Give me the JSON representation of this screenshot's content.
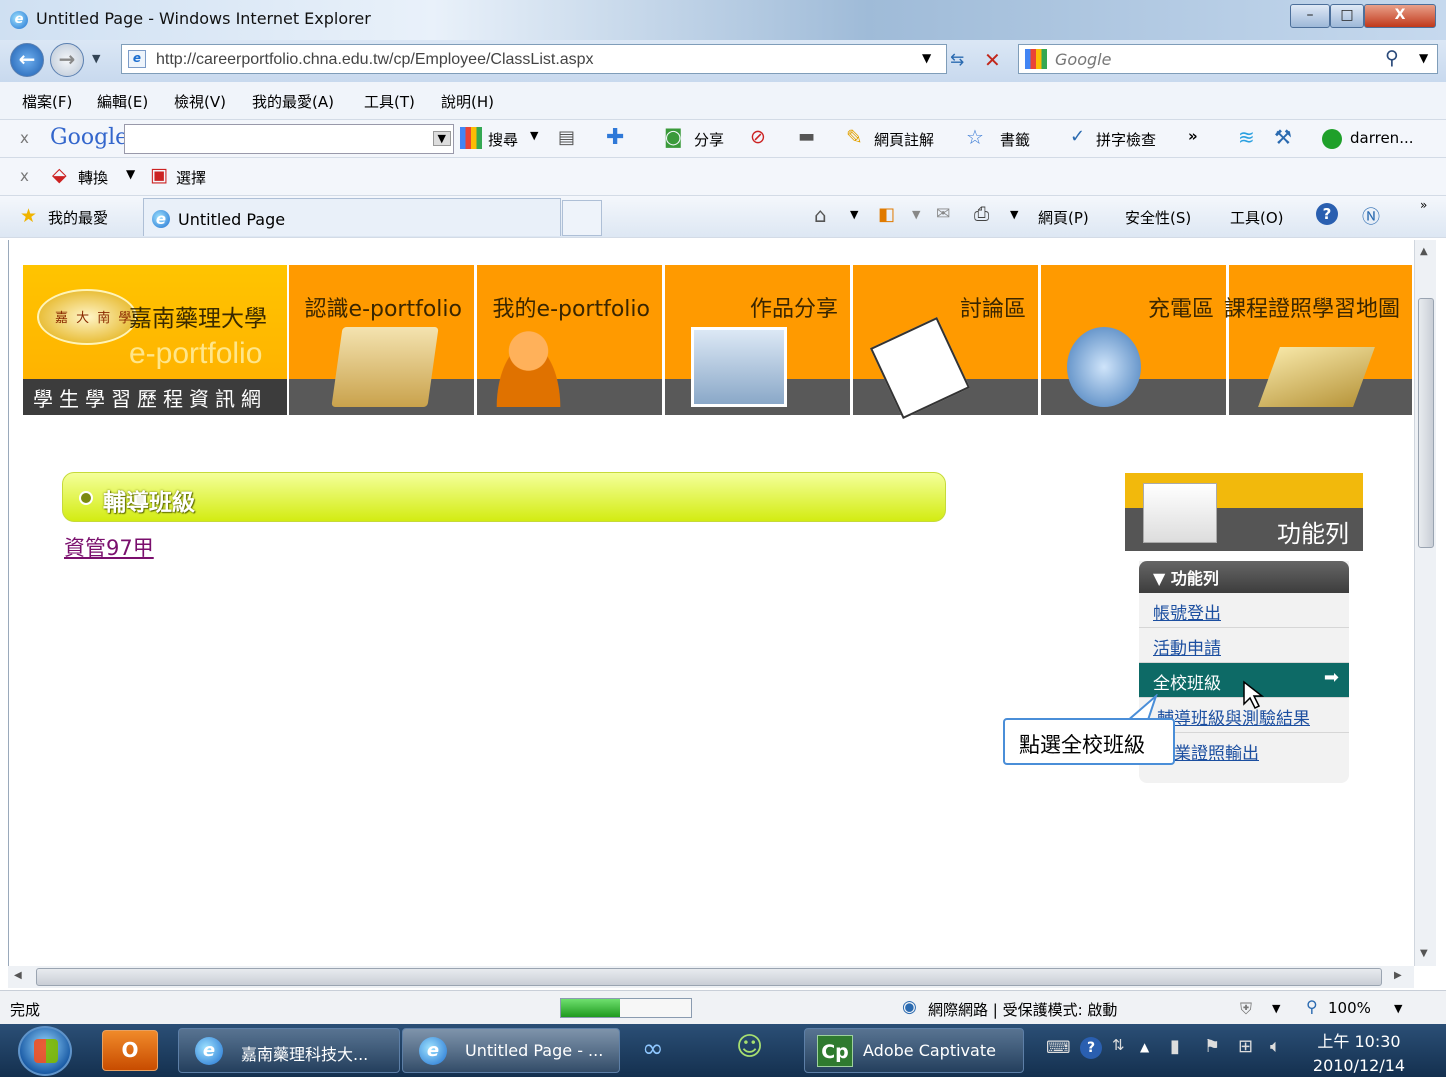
{
  "window": {
    "title": "Untitled Page - Windows Internet Explorer",
    "minimize": "–",
    "maximize": "□",
    "close": "X"
  },
  "address": {
    "url": "http://careerportfolio.chna.edu.tw/cp/Employee/ClassList.aspx",
    "search_placeholder": "Google"
  },
  "menu": [
    "檔案(F)",
    "編輯(E)",
    "檢視(V)",
    "我的最愛(A)",
    "工具(T)",
    "說明(H)"
  ],
  "google_toolbar": {
    "logo": "Google",
    "search_btn": "搜尋",
    "share": "分享",
    "annotate": "網頁註解",
    "bookmarks": "書籤",
    "spellcheck": "拼字檢查",
    "more": "»",
    "account": "darren..."
  },
  "extra_toolbar": {
    "convert": "轉換",
    "select": "選擇"
  },
  "favorites_bar": {
    "favorites": "我的最愛",
    "tab_title": "Untitled Page",
    "page_menu": "網頁(P)",
    "safety_menu": "安全性(S)",
    "tools_menu": "工具(O)",
    "more": "»"
  },
  "site": {
    "school": "嘉南藥理大學",
    "portfolio": "e-portfolio",
    "subtitle": "學生學習歷程資訊網",
    "seal_text": "嘉 大 南 學",
    "nav": [
      "認識e-portfolio",
      "我的e-portfolio",
      "作品分享",
      "討論區",
      "充電區",
      "課程證照學習地圖"
    ]
  },
  "section": {
    "title": "輔導班級",
    "class_link": "資管97甲"
  },
  "function_panel": {
    "header": "功能列",
    "title": "▼ 功能列",
    "items": [
      "帳號登出",
      "活動申請",
      "全校班級",
      "輔導班級與測驗結果",
      "專業證照輸出"
    ],
    "active_index": 2,
    "arrow": "➡"
  },
  "callout": "點選全校班級",
  "status_bar": {
    "text": "完成",
    "progress": 0.45,
    "zone": "網際網路 | 受保護模式: 啟動",
    "zoom": "100%"
  },
  "taskbar": {
    "tasks": [
      "嘉南藥理科技大...",
      "Untitled Page - ...",
      "Adobe Captivate"
    ],
    "time": "上午 10:30",
    "date": "2010/12/14"
  },
  "colors": {
    "orange": "#ff9a00",
    "banner_dark": "#595959",
    "active_teal": "#0d6a66",
    "link": "#1c4fa0",
    "section_green": "#d3ec12"
  }
}
